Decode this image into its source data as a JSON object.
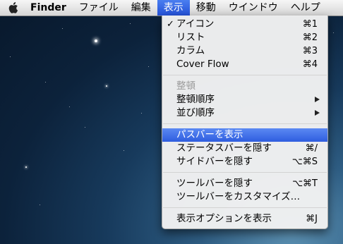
{
  "menubar": {
    "apple_icon": "apple-logo-icon",
    "app_name": "Finder",
    "menus": [
      "ファイル",
      "編集",
      "表示",
      "移動",
      "ウインドウ",
      "ヘルプ"
    ],
    "active_menu": "表示"
  },
  "view_menu": {
    "group1": [
      {
        "label": "アイコン",
        "shortcut": "⌘1",
        "checked": true
      },
      {
        "label": "リスト",
        "shortcut": "⌘2"
      },
      {
        "label": "カラム",
        "shortcut": "⌘3"
      },
      {
        "label": "Cover Flow",
        "shortcut": "⌘4"
      }
    ],
    "group2": [
      {
        "label": "整頓",
        "disabled": true
      },
      {
        "label": "整頓順序",
        "submenu": true
      },
      {
        "label": "並び順序",
        "submenu": true
      }
    ],
    "group3": [
      {
        "label": "パスバーを表示",
        "highlighted": true
      },
      {
        "label": "ステータスバーを隠す",
        "shortcut": "⌘/"
      },
      {
        "label": "サイドバーを隠す",
        "shortcut": "⌥⌘S"
      }
    ],
    "group4": [
      {
        "label": "ツールバーを隠す",
        "shortcut": "⌥⌘T"
      },
      {
        "label": "ツールバーをカスタマイズ…"
      }
    ],
    "group5": [
      {
        "label": "表示オプションを表示",
        "shortcut": "⌘J"
      }
    ],
    "check_mark": "✓"
  },
  "colors": {
    "menu_highlight": "#3266e0",
    "desktop_background": "#0c223b"
  }
}
